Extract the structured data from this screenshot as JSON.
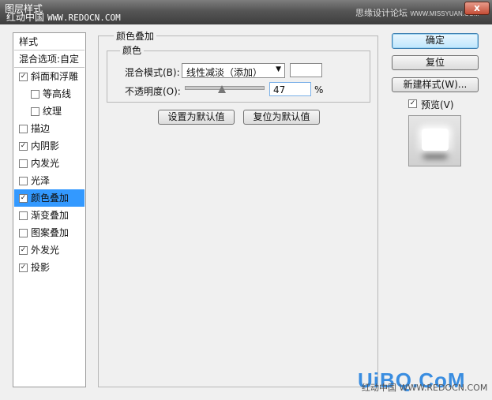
{
  "window": {
    "title": "图层样式",
    "close_label": "x"
  },
  "watermarks": {
    "top_left_cn": "红动中国",
    "top_left_en": "WWW.REDOCN.COM",
    "top_right_cn": "思缘设计论坛",
    "top_right_en": "WWW.MISSYUAN.COM",
    "bottom_brand": "UiBQ.CoM",
    "bottom_small": "红动中国 WWW.REDOCN.COM"
  },
  "styles_panel": {
    "header": "样式",
    "blend_options": "混合选项:自定",
    "items": [
      {
        "label": "斜面和浮雕",
        "checked": true,
        "sub": false,
        "selected": false
      },
      {
        "label": "等高线",
        "checked": false,
        "sub": true,
        "selected": false
      },
      {
        "label": "纹理",
        "checked": false,
        "sub": true,
        "selected": false
      },
      {
        "label": "描边",
        "checked": false,
        "sub": false,
        "selected": false
      },
      {
        "label": "内阴影",
        "checked": true,
        "sub": false,
        "selected": false
      },
      {
        "label": "内发光",
        "checked": false,
        "sub": false,
        "selected": false
      },
      {
        "label": "光泽",
        "checked": false,
        "sub": false,
        "selected": false
      },
      {
        "label": "颜色叠加",
        "checked": true,
        "sub": false,
        "selected": true
      },
      {
        "label": "渐变叠加",
        "checked": false,
        "sub": false,
        "selected": false
      },
      {
        "label": "图案叠加",
        "checked": false,
        "sub": false,
        "selected": false
      },
      {
        "label": "外发光",
        "checked": true,
        "sub": false,
        "selected": false
      },
      {
        "label": "投影",
        "checked": true,
        "sub": false,
        "selected": false
      }
    ]
  },
  "color_overlay": {
    "group_title": "颜色叠加",
    "subgroup_title": "颜色",
    "blend_mode_label": "混合模式(B):",
    "blend_mode_value": "线性减淡（添加）",
    "swatch_color": "#ffffff",
    "opacity_label": "不透明度(O):",
    "opacity_value": "47",
    "opacity_fraction": 0.47,
    "opacity_unit": "%",
    "make_default": "设置为默认值",
    "reset_default": "复位为默认值"
  },
  "right_buttons": {
    "ok": "确定",
    "reset": "复位",
    "new_style": "新建样式(W)...",
    "preview_label": "预览(V)",
    "preview_checked": true
  },
  "colors": {
    "selection": "#3399ff",
    "titlebar": "#555555",
    "dialog_bg": "#f0f0f0"
  }
}
